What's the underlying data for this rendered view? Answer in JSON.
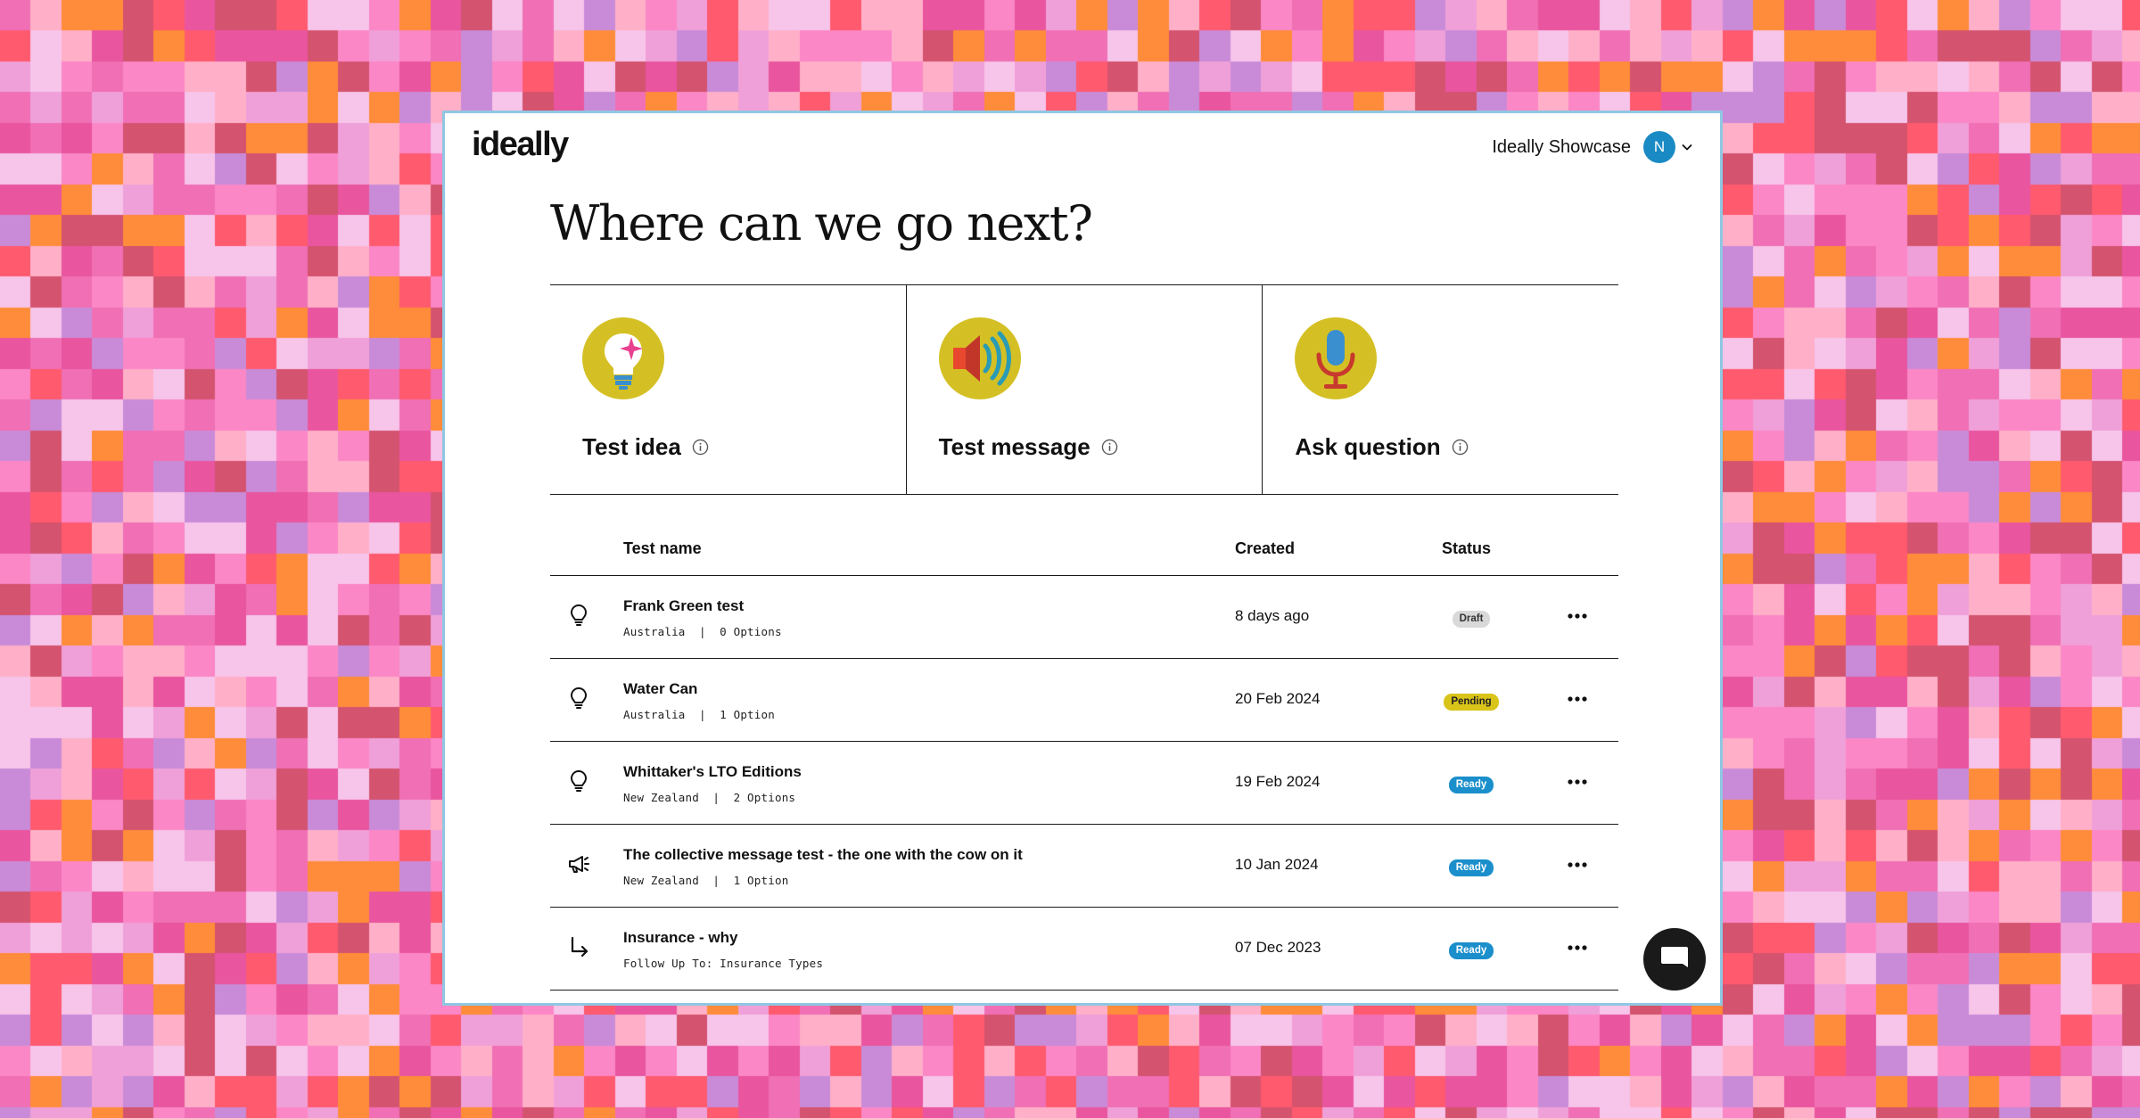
{
  "background": {
    "palette": [
      "#f06fb5",
      "#f0a0d8",
      "#ff8c3a",
      "#e9559f",
      "#c98bd8",
      "#ff5a6e",
      "#f7c4ea",
      "#d4536f",
      "#fb87c6",
      "#ffb0c8"
    ]
  },
  "header": {
    "logo": "ideally",
    "account_name": "Ideally Showcase",
    "avatar_initial": "N",
    "avatar_color": "#1a8ac4"
  },
  "headline": "Where can we go next?",
  "cards": [
    {
      "label": "Test idea",
      "icon": "lightbulb-icon"
    },
    {
      "label": "Test message",
      "icon": "speaker-icon"
    },
    {
      "label": "Ask question",
      "icon": "microphone-icon"
    }
  ],
  "table": {
    "columns": {
      "name": "Test name",
      "created": "Created",
      "status": "Status"
    },
    "rows": [
      {
        "icon": "lightbulb-icon",
        "name": "Frank Green test",
        "meta": "Australia  |  0 Options",
        "created": "8 days ago",
        "status": "Draft"
      },
      {
        "icon": "lightbulb-icon",
        "name": "Water Can",
        "meta": "Australia  |  1 Option",
        "created": "20 Feb 2024",
        "status": "Pending"
      },
      {
        "icon": "lightbulb-icon",
        "name": "Whittaker's LTO Editions",
        "meta": "New Zealand  |  2 Options",
        "created": "19 Feb 2024",
        "status": "Ready"
      },
      {
        "icon": "megaphone-icon",
        "name": "The collective message test - the one with the cow on it",
        "meta": "New Zealand  |  1 Option",
        "created": "10 Jan 2024",
        "status": "Ready"
      },
      {
        "icon": "follow-up-arrow-icon",
        "name": "Insurance - why",
        "meta": "Follow Up To: Insurance Types",
        "created": "07 Dec 2023",
        "status": "Ready"
      }
    ]
  },
  "colors": {
    "accent_yellow": "#d4c024",
    "draft": "#d9d9d9",
    "pending": "#d9c41a",
    "ready": "#1b8fcb",
    "window_border": "#8fc7e2"
  }
}
